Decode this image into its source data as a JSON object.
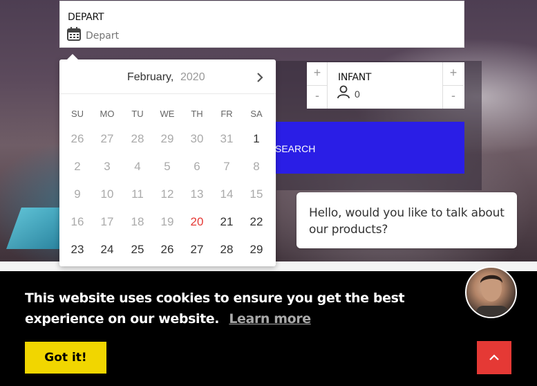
{
  "depart": {
    "label": "DEPART",
    "placeholder": "Depart"
  },
  "infant": {
    "label": "INFANT",
    "value": "0",
    "plus": "+",
    "minus": "-"
  },
  "search": {
    "label": "SEARCH"
  },
  "calendar": {
    "month": "February,",
    "year": "2020",
    "weekdays": [
      "SU",
      "MO",
      "TU",
      "WE",
      "TH",
      "FR",
      "SA"
    ],
    "weeks": [
      [
        "26",
        "27",
        "28",
        "29",
        "30",
        "31",
        "1"
      ],
      [
        "2",
        "3",
        "4",
        "5",
        "6",
        "7",
        "8"
      ],
      [
        "9",
        "10",
        "11",
        "12",
        "13",
        "14",
        "15"
      ],
      [
        "16",
        "17",
        "18",
        "19",
        "20",
        "21",
        "22"
      ],
      [
        "23",
        "24",
        "25",
        "26",
        "27",
        "28",
        "29"
      ]
    ],
    "today": "20"
  },
  "chat": {
    "message": "Hello, would you like to talk about our products?"
  },
  "cookie": {
    "message": "This website uses cookies to ensure you get the best experience on our website.",
    "link": "Learn more",
    "button": "Got it!"
  },
  "colors": {
    "accent": "#2a1ee6",
    "today": "#e53935",
    "cookie_button": "#f1d600",
    "scroll_top": "#e53935"
  }
}
